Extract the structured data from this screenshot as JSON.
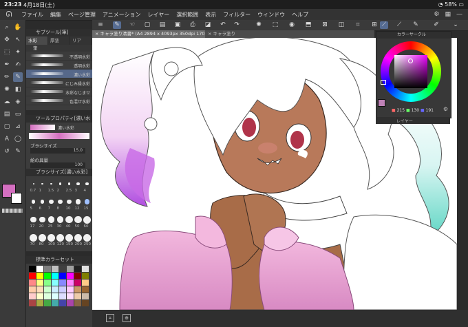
{
  "status": {
    "time": "23:23",
    "date": "4月18日(土)",
    "battery": "58%"
  },
  "menu": [
    "ファイル",
    "編集",
    "ページ管理",
    "アニメーション",
    "レイヤー",
    "選択範囲",
    "表示",
    "フィルター",
    "ウィンドウ",
    "ヘルプ"
  ],
  "subtool": {
    "title": "サブツール[筆]",
    "tabs": [
      "水彩",
      "厚塗",
      "リア"
    ],
    "group": "筆",
    "brushes": [
      "不透明水彩",
      "透明水彩",
      "濃い水彩",
      "にじみ縁水彩",
      "水彩なじませ",
      "色混ぜ水彩"
    ],
    "selected_brush": "濃い水彩"
  },
  "toolprop": {
    "title": "ツールプロパティ[濃い水",
    "brush_name": "濃い水彩",
    "size_label": "ブラシサイズ",
    "size_value": "15.0",
    "density_label": "絵の具量",
    "density_value": "100"
  },
  "brushsize": {
    "title": "ブラシサイズ[濃い水彩]",
    "labels": [
      "0.7",
      "1",
      "1.5",
      "2",
      "2.5",
      "3",
      "4",
      "5",
      "6",
      "7",
      "8",
      "10",
      "12",
      "15",
      "17",
      "20",
      "25",
      "30",
      "40",
      "50",
      "60",
      "70",
      "80",
      "100",
      "120",
      "150",
      "200",
      "250"
    ]
  },
  "colorset": {
    "title": "標準カラーセット"
  },
  "canvas": {
    "tab1": "キャラ塗り清書* (A4 2894 x 4093px 350dpi 170.4%)",
    "tab2": "キャラ塗り"
  },
  "colorwheel": {
    "title": "カラーサークル",
    "h": "215",
    "s": "130",
    "v": "191",
    "color": "#bf82b7"
  },
  "layer": {
    "title": "レイヤー"
  },
  "colors": {
    "main": "#d46fc0",
    "sub": "#ffffff",
    "accent": "#566c92"
  }
}
